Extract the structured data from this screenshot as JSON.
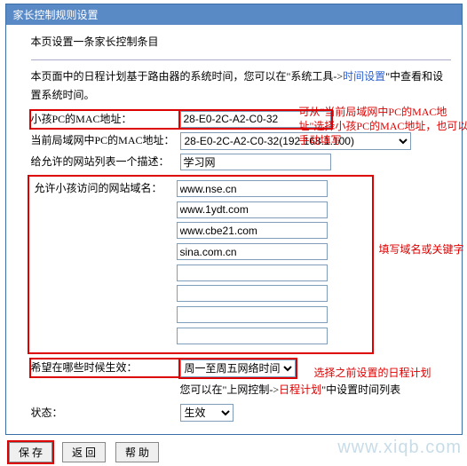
{
  "header": {
    "title": "家长控制规则设置"
  },
  "intro": "本页设置一条家长控制条目",
  "paragraph1_prefix": "本页面中的日程计划基于路由器的系统时间，您可以在\"系统工具->",
  "paragraph1_link": "时间设置",
  "paragraph1_suffix": "\"中查看和设置系统时间。",
  "notes": {
    "macNote": "可从\"当前局域网中PC的MAC地址\"选择小孩PC的MAC地址，也可以手动填写",
    "domainNote": "填写域名或关键字",
    "scheduleNote": "选择之前设置的日程计划"
  },
  "fields": {
    "childMacLabel": "小孩PC的MAC地址：",
    "childMacValue": "28-E0-2C-A2-C0-32",
    "lanMacLabel": "当前局域网中PC的MAC地址：",
    "lanMacValue": "28-E0-2C-A2-C0-32(192.168.1.100)",
    "descLabel": "给允许的网站列表一个描述：",
    "descValue": "学习网",
    "domainLabel": "允许小孩访问的网站域名：",
    "domains": [
      "www.nse.cn",
      "www.1ydt.com",
      "www.cbe21.com",
      "sina.com.cn",
      "",
      "",
      "",
      ""
    ],
    "scheduleLabel": "希望在哪些时候生效：",
    "scheduleValue": "周一至周五网络时间",
    "scheduleHint_prefix": "您可以在\"上网控制->",
    "scheduleHint_link": "日程计划",
    "scheduleHint_suffix": "\"中设置时间列表",
    "statusLabel": "状态：",
    "statusValue": "生效"
  },
  "buttons": {
    "save": "保 存",
    "back": "返 回",
    "help": "帮 助"
  },
  "watermark": "www.xiqb.com"
}
